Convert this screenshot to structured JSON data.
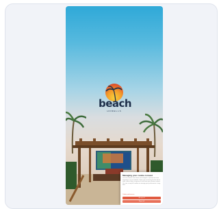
{
  "colors": {
    "card_bg": "#f1f3f8",
    "sky_top": "#2fa9d8",
    "logo_text": "#1e2f4a",
    "sun": "#f39a2a",
    "accent_button": "#e05a40"
  },
  "logo": {
    "wordmark": "beach",
    "subtitle": "HOMELLS"
  },
  "cookie_banner": {
    "title": "Managing your cookie consent",
    "text": "We use cookies and similar technologies to provide the best experience on our website. Some are necessary for the site to work, others help us improve it and show you relevant content. You can accept all cookies or manage your preferences at any time.",
    "link": "Cookie preferences",
    "accept_label": "Accept all",
    "reject_label": "Reject all"
  },
  "icons": [
    "palm-tree-icon",
    "sun-icon"
  ]
}
